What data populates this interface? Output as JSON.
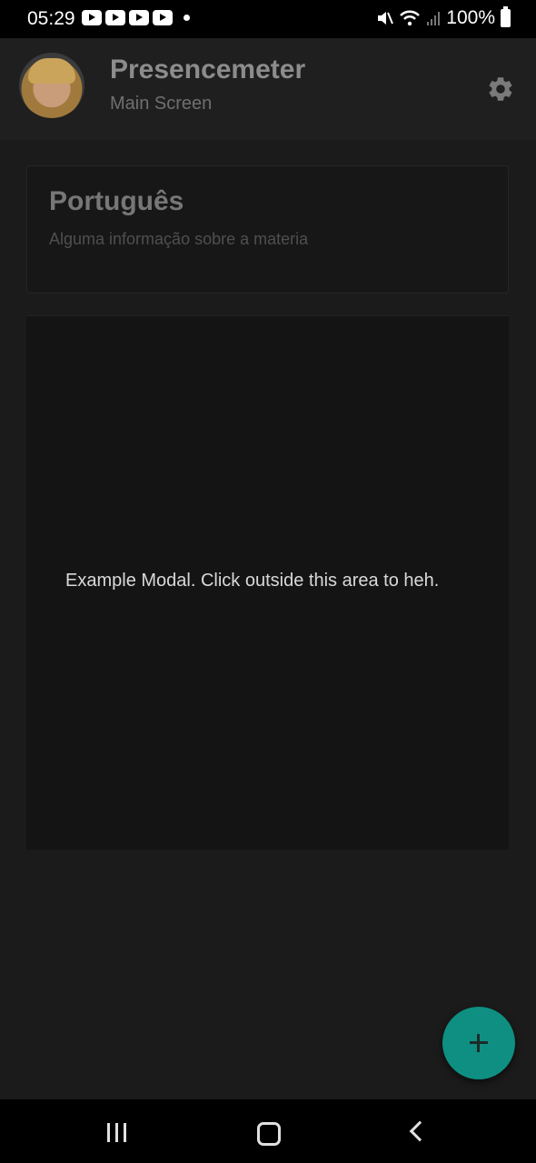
{
  "status_bar": {
    "time": "05:29",
    "battery": "100%",
    "notification_icons": [
      "youtube-icon",
      "youtube-icon",
      "youtube-icon",
      "youtube-icon"
    ]
  },
  "header": {
    "title": "Presencemeter",
    "subtitle": "Main Screen",
    "settings_icon": "gear-icon"
  },
  "subject_card": {
    "title": "Português",
    "info": "Alguma informação sobre a materia"
  },
  "modal": {
    "message": "Example Modal.  Click outside this area to heh."
  },
  "fab": {
    "icon": "plus-icon",
    "color": "#0e8f81"
  },
  "nav_bar": {
    "buttons": [
      "recent-apps",
      "home",
      "back"
    ]
  }
}
